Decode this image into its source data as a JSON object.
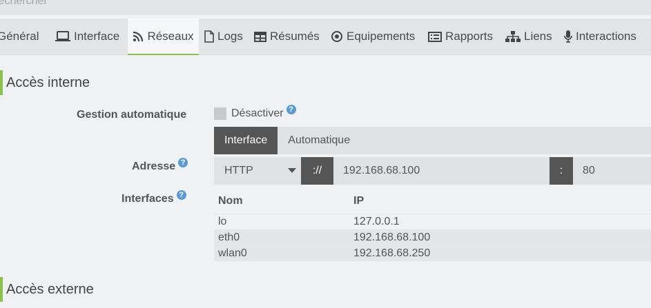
{
  "search": {
    "placeholder": "Rechercher"
  },
  "nav": {
    "tabs": [
      {
        "label": "Général"
      },
      {
        "label": "Interface"
      },
      {
        "label": "Réseaux"
      },
      {
        "label": "Logs"
      },
      {
        "label": "Résumés"
      },
      {
        "label": "Equipements"
      },
      {
        "label": "Rapports"
      },
      {
        "label": "Liens"
      },
      {
        "label": "Interactions"
      }
    ],
    "active": "Réseaux"
  },
  "internal": {
    "title": "Accès interne",
    "auto_label": "Gestion automatique",
    "disable_label": "Désactiver",
    "mode_tabs": [
      "Interface",
      "Automatique"
    ],
    "mode_selected": "Interface",
    "address_label": "Adresse",
    "protocol": "HTTP",
    "scheme_sep": "://",
    "ip": "192.168.68.100",
    "port_sep": ":",
    "port": "80",
    "interfaces_label": "Interfaces",
    "table": {
      "headers": [
        "Nom",
        "IP"
      ],
      "rows": [
        {
          "name": "lo",
          "ip": "127.0.0.1"
        },
        {
          "name": "eth0",
          "ip": "192.168.68.100"
        },
        {
          "name": "wlan0",
          "ip": "192.168.68.250"
        }
      ]
    }
  },
  "external": {
    "title": "Accès externe"
  },
  "help_glyph": "?",
  "colors": {
    "accent": "#8bc34a",
    "help": "#5b9bd5",
    "dark": "#555555"
  }
}
